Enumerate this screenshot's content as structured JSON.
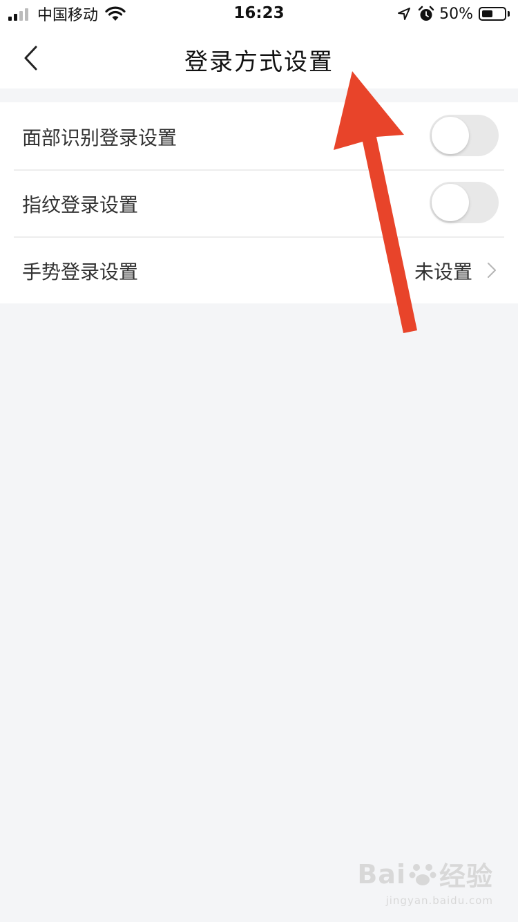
{
  "status_bar": {
    "carrier": "中国移动",
    "time": "16:23",
    "battery_percent": "50%",
    "battery_level": 0.5,
    "signal_icon": "signal-bars-icon",
    "wifi_icon": "wifi-icon",
    "location_icon": "location-arrow-icon",
    "alarm_icon": "alarm-clock-icon"
  },
  "nav": {
    "title": "登录方式设置",
    "back_icon": "chevron-left-icon"
  },
  "settings": {
    "items": [
      {
        "label": "面部识别登录设置",
        "type": "toggle",
        "on": false
      },
      {
        "label": "指纹登录设置",
        "type": "toggle",
        "on": false
      },
      {
        "label": "手势登录设置",
        "type": "link",
        "value": "未设置"
      }
    ]
  },
  "annotation": {
    "arrow_color": "#e8442a"
  },
  "watermark": {
    "logo": "Bai",
    "logo2": "经验",
    "url": "jingyan.baidu.com"
  },
  "colors": {
    "background": "#f4f5f7",
    "toggle_off": "#e8e8e8",
    "text": "#333333"
  }
}
